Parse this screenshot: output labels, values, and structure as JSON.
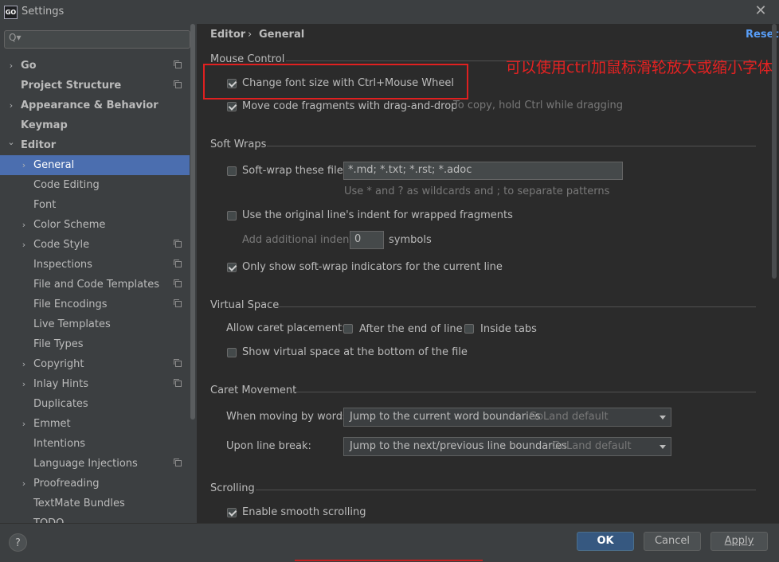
{
  "window": {
    "app_icon_text": "GO",
    "title": "Settings",
    "close_glyph": "✕"
  },
  "search": {
    "placeholder": "",
    "icon": "search-icon",
    "glyph": "Q▾"
  },
  "sidebar": {
    "items": [
      {
        "label": "Go",
        "level": 0,
        "expandable": true,
        "bold": true,
        "project_icon": true
      },
      {
        "label": "Project Structure",
        "level": 0,
        "expandable": false,
        "bold": true,
        "project_icon": true
      },
      {
        "label": "Appearance & Behavior",
        "level": 0,
        "expandable": true,
        "bold": true,
        "project_icon": false
      },
      {
        "label": "Keymap",
        "level": 0,
        "expandable": false,
        "bold": true,
        "project_icon": false
      },
      {
        "label": "Editor",
        "level": 0,
        "expandable": true,
        "expanded": true,
        "bold": true,
        "project_icon": false
      },
      {
        "label": "General",
        "level": 1,
        "expandable": true,
        "selected": true,
        "project_icon": false
      },
      {
        "label": "Code Editing",
        "level": 1,
        "expandable": false,
        "project_icon": false
      },
      {
        "label": "Font",
        "level": 1,
        "expandable": false,
        "project_icon": false
      },
      {
        "label": "Color Scheme",
        "level": 1,
        "expandable": true,
        "project_icon": false
      },
      {
        "label": "Code Style",
        "level": 1,
        "expandable": true,
        "project_icon": true
      },
      {
        "label": "Inspections",
        "level": 1,
        "expandable": false,
        "project_icon": true
      },
      {
        "label": "File and Code Templates",
        "level": 1,
        "expandable": false,
        "project_icon": true
      },
      {
        "label": "File Encodings",
        "level": 1,
        "expandable": false,
        "project_icon": true
      },
      {
        "label": "Live Templates",
        "level": 1,
        "expandable": false,
        "project_icon": false
      },
      {
        "label": "File Types",
        "level": 1,
        "expandable": false,
        "project_icon": false
      },
      {
        "label": "Copyright",
        "level": 1,
        "expandable": true,
        "project_icon": true
      },
      {
        "label": "Inlay Hints",
        "level": 1,
        "expandable": true,
        "project_icon": true
      },
      {
        "label": "Duplicates",
        "level": 1,
        "expandable": false,
        "project_icon": false
      },
      {
        "label": "Emmet",
        "level": 1,
        "expandable": true,
        "project_icon": false
      },
      {
        "label": "Intentions",
        "level": 1,
        "expandable": false,
        "project_icon": false
      },
      {
        "label": "Language Injections",
        "level": 1,
        "expandable": false,
        "project_icon": true
      },
      {
        "label": "Proofreading",
        "level": 1,
        "expandable": true,
        "project_icon": false
      },
      {
        "label": "TextMate Bundles",
        "level": 1,
        "expandable": false,
        "project_icon": false
      },
      {
        "label": "TODO",
        "level": 1,
        "expandable": false,
        "project_icon": false
      }
    ]
  },
  "breadcrumb": {
    "parent": "Editor",
    "separator": "›",
    "current": "General",
    "reset": "Reset"
  },
  "mouse_control": {
    "title": "Mouse Control",
    "change_font": {
      "label": "Change font size with Ctrl+Mouse Wheel",
      "checked": true
    },
    "move_code": {
      "label": "Move code fragments with drag-and-drop",
      "checked": true,
      "hint": "To copy, hold Ctrl while dragging"
    }
  },
  "soft_wraps": {
    "title": "Soft Wraps",
    "soft_wrap_files": {
      "label": "Soft-wrap these files:",
      "checked": false,
      "value": "*.md; *.txt; *.rst; *.adoc"
    },
    "wildcard_hint": "Use * and ? as wildcards and ; to separate patterns",
    "original_indent": {
      "label": "Use the original line's indent for wrapped fragments",
      "checked": false
    },
    "additional_indent": {
      "label": "Add additional indent:",
      "value": "0",
      "suffix": "symbols"
    },
    "only_current_line": {
      "label": "Only show soft-wrap indicators for the current line",
      "checked": true
    }
  },
  "virtual_space": {
    "title": "Virtual Space",
    "caret_label": "Allow caret placement:",
    "after_end": {
      "label": "After the end of line",
      "checked": false
    },
    "inside_tabs": {
      "label": "Inside tabs",
      "checked": false
    },
    "show_bottom": {
      "label": "Show virtual space at the bottom of the file",
      "checked": false
    }
  },
  "caret_movement": {
    "title": "Caret Movement",
    "words_label": "When moving by words:",
    "words_value": "Jump to the current word boundaries",
    "words_default": "GoLand default",
    "line_label": "Upon line break:",
    "line_value": "Jump to the next/previous line boundaries",
    "line_default": "GoLand default"
  },
  "scrolling": {
    "title": "Scrolling",
    "smooth": {
      "label": "Enable smooth scrolling",
      "checked": true
    }
  },
  "annotation": {
    "text": "可以使用ctrl加鼠标滑轮放大或缩小字体",
    "color": "#e52222"
  },
  "footer": {
    "help": "?",
    "ok": "OK",
    "cancel": "Cancel",
    "apply": "Apply"
  },
  "colors": {
    "selection": "#4b6eaf",
    "link": "#589df6",
    "primary_button": "#365880",
    "highlight": "#e02020"
  }
}
